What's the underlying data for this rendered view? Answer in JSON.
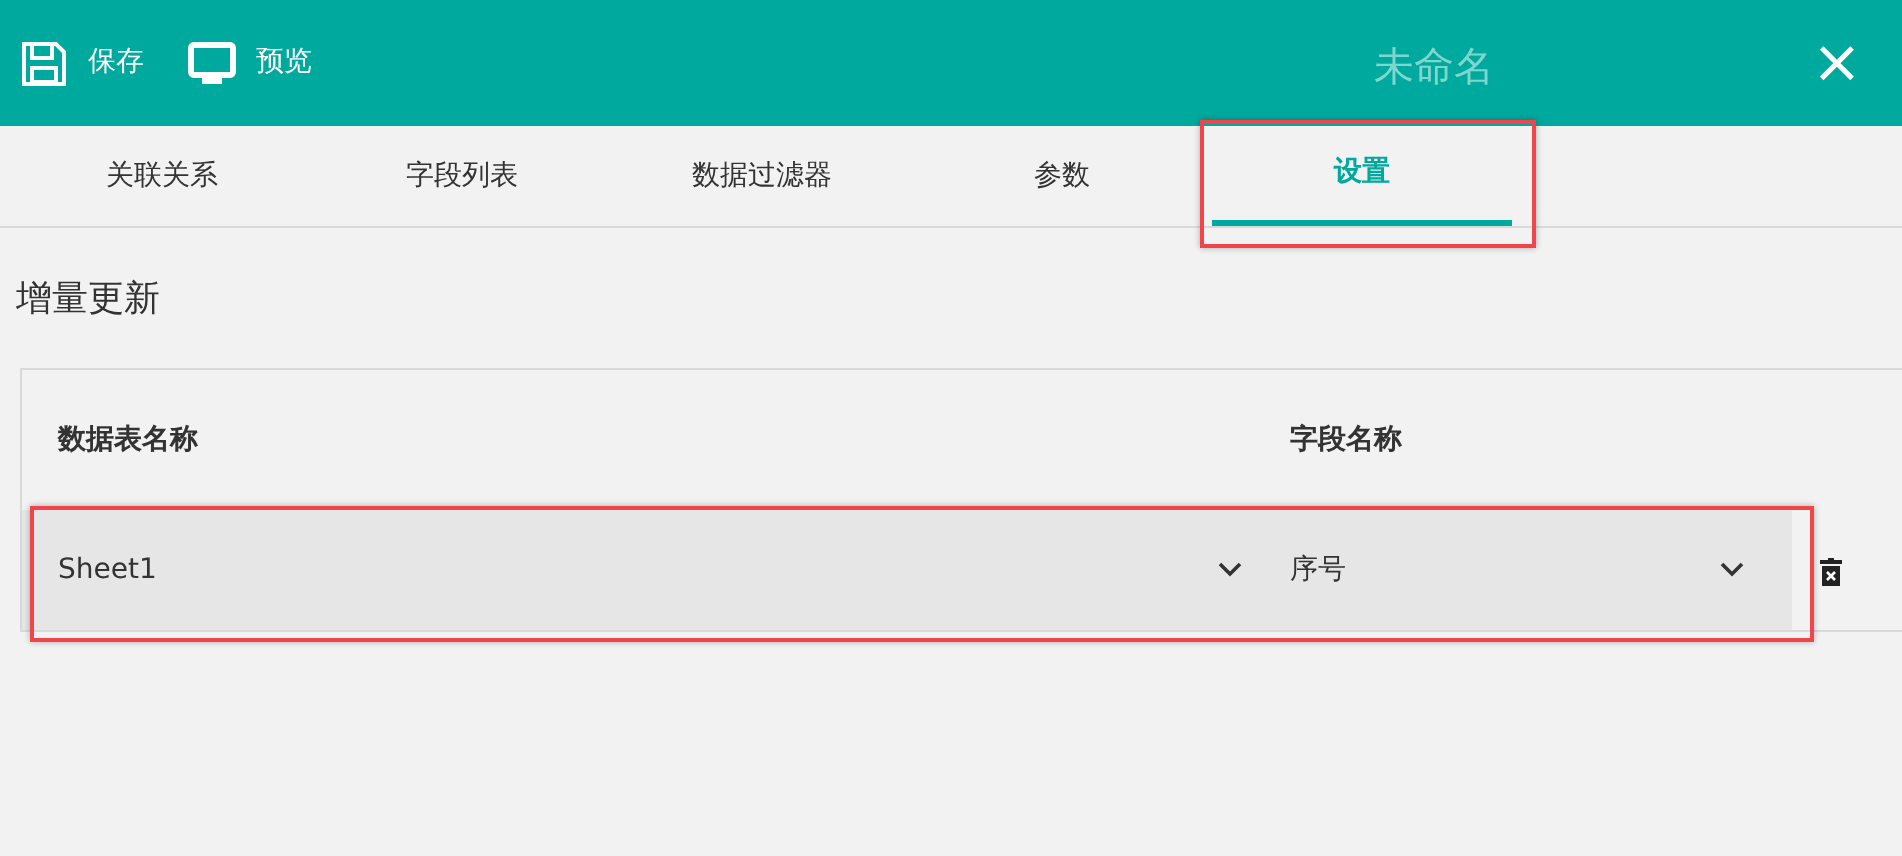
{
  "toolbar": {
    "buttons": [
      {
        "kind": "save",
        "label": "保存"
      },
      {
        "kind": "preview",
        "label": "预览"
      }
    ],
    "title": "未命名",
    "close": "×"
  },
  "tabs": [
    {
      "label": "关联关系",
      "selected": false,
      "highlighted": false
    },
    {
      "label": "字段列表",
      "selected": false,
      "highlighted": false
    },
    {
      "label": "数据过滤器",
      "selected": false,
      "highlighted": false
    },
    {
      "label": "参数",
      "selected": false,
      "highlighted": false
    },
    {
      "label": "设置",
      "selected": true,
      "highlighted": true
    }
  ],
  "section_title": "增量更新",
  "table": {
    "columns": [
      "数据表名称",
      "字段名称"
    ],
    "rows": [
      {
        "table_name": "Sheet1",
        "field_name": "序号",
        "highlighted": true
      }
    ]
  }
}
